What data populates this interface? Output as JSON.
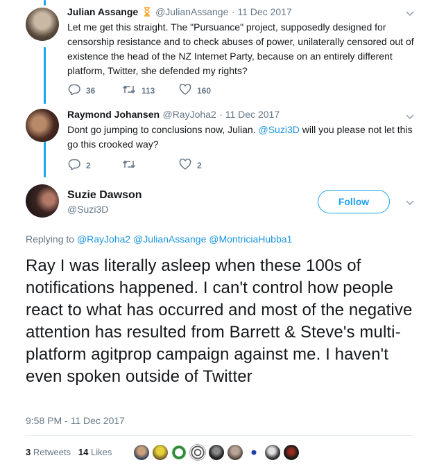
{
  "tweet1": {
    "name": "Julian Assange",
    "badge_icon": "hourglass-icon",
    "handle": "@JulianAssange",
    "date": "· 11 Dec 2017",
    "text": "Let me get this straight. The \"Pursuance\" project, supposedly designed for censorship resistance and to check abuses of power, unilaterally censored out of existence the head of the NZ Internet Party, because on an entirely different platform, Twitter, she defended my rights?",
    "replies": "36",
    "retweets": "113",
    "likes": "160"
  },
  "tweet2": {
    "name": "Raymond Johansen",
    "handle": "@RayJoha2",
    "date": "· 11 Dec 2017",
    "text_before": "Dont go jumping to conclusions now, Julian. ",
    "mention": "@Suzi3D",
    "text_after": " will you please not let this go this crooked way?",
    "replies": "2",
    "retweets": "",
    "likes": "2"
  },
  "main": {
    "name": "Suzie Dawson",
    "handle": "@Suzi3D",
    "follow_label": "Follow",
    "replying_prefix": "Replying to ",
    "replying_to": [
      "@RayJoha2",
      "@JulianAssange",
      "@MontriciaHubba1"
    ],
    "text": "Ray I was literally asleep when these 100s of notifications happened. I can't control how people react to what has occurred and most of the negative attention has resulted from Barrett & Steve's multi-platform agitprop campaign against me. I haven't even spoken outside of Twitter",
    "timestamp": "9:58 PM - 11 Dec 2017",
    "retweet_count": "3",
    "retweet_label": "Retweets",
    "like_count": "14",
    "like_label": "Likes"
  },
  "colors": {
    "accent": "#1da1f2",
    "link": "#1b95e0",
    "muted": "#657786"
  }
}
